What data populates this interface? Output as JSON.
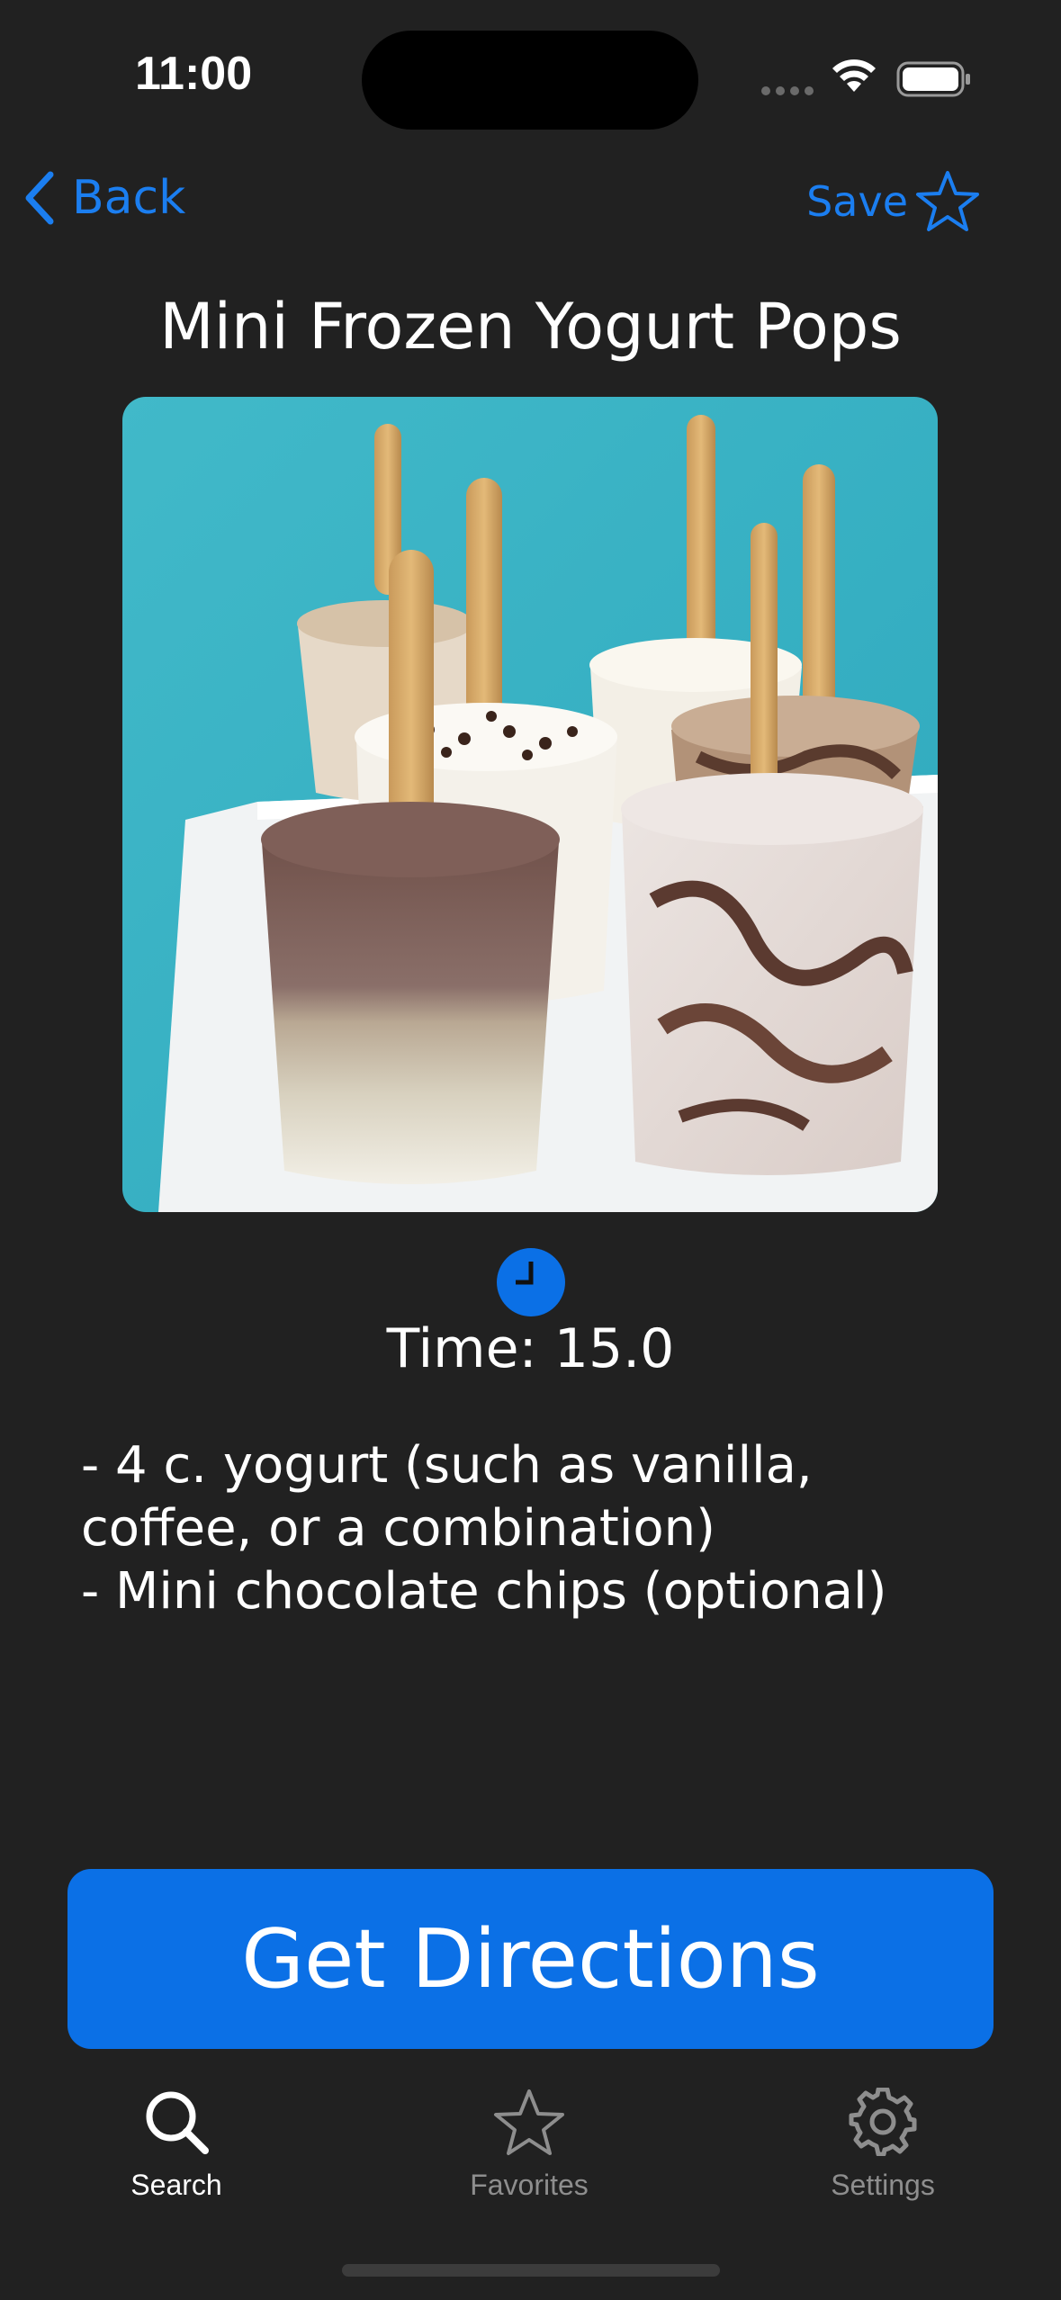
{
  "status_bar": {
    "time": "11:00"
  },
  "nav": {
    "back_label": "Back",
    "save_label": "Save"
  },
  "recipe": {
    "title": "Mini Frozen Yogurt Pops",
    "time_text": "Time: 15.0",
    "ingredients": [
      "- 4 c. yogurt (such as vanilla, coffee, or a combination)",
      "- Mini chocolate chips (optional)"
    ]
  },
  "actions": {
    "directions_label": "Get Directions"
  },
  "tab_bar": {
    "items": [
      {
        "label": "Search",
        "icon": "search-icon",
        "active": true
      },
      {
        "label": "Favorites",
        "icon": "star-icon",
        "active": false
      },
      {
        "label": "Settings",
        "icon": "gear-icon",
        "active": false
      }
    ]
  },
  "colors": {
    "background": "#212121",
    "accent": "#1b7ef0",
    "button": "#0b70e6",
    "tab_active": "#ffffff",
    "tab_inactive": "#8e8e8e"
  }
}
